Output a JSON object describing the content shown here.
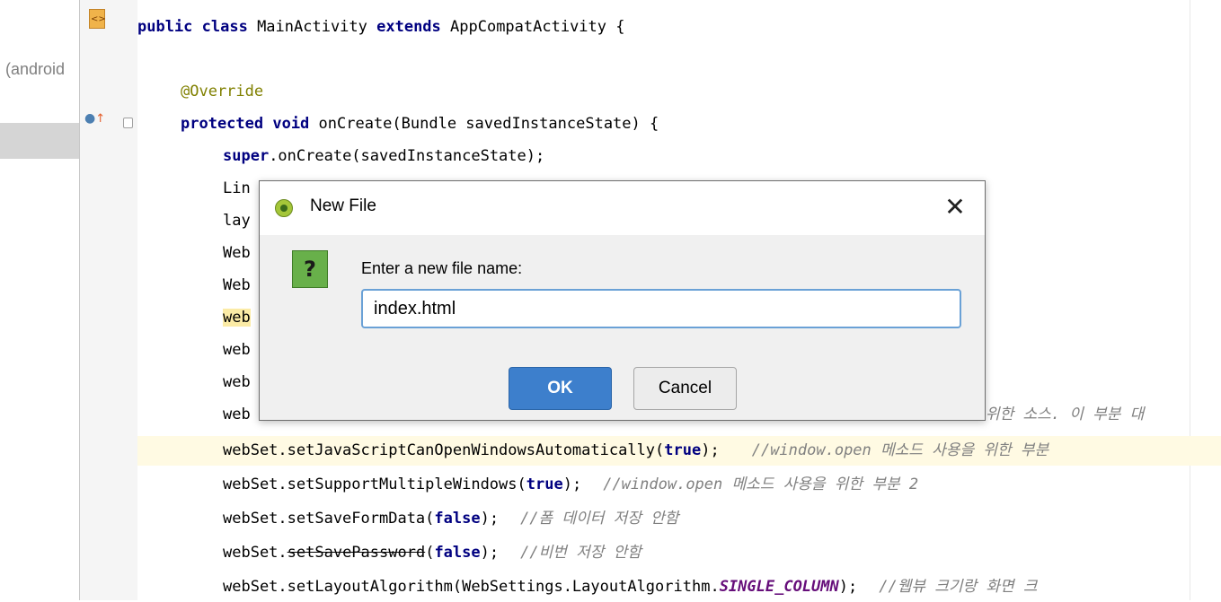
{
  "sidebar": {
    "project_label": "(android"
  },
  "gutter": {
    "file_icon_glyph": "<>"
  },
  "code": {
    "line_1": {
      "kw1": "public class",
      "t1": " MainActivity ",
      "kw2": "extends",
      "t2": " AppCompatActivity {"
    },
    "line_3": {
      "annotation": "@Override"
    },
    "line_4": {
      "kw1": "protected void",
      "t1": " onCreate(Bundle savedInstanceState) {"
    },
    "line_5": {
      "kw1": "super",
      "t1": ".onCreate(savedInstanceState);"
    },
    "line_6": "Lin",
    "line_7": "lay",
    "line_8": "Web",
    "line_9": "Web",
    "line_10": "web",
    "line_11": "web",
    "line_12": "web",
    "line_13": {
      "t1": "web",
      "comment": "위한 소스. 이 부분 대"
    },
    "line_14": {
      "t1": "webSet.setJavaScriptCanOpenWindowsAutomatically(",
      "kw": "true",
      "t2": ");",
      "comment": "//window.open 메소드 사용을 위한 부분"
    },
    "line_15": {
      "t1": "webSet.setSupportMultipleWindows(",
      "kw": "true",
      "t2": ");",
      "comment": "//window.open 메소드 사용을 위한 부분 2"
    },
    "line_16": {
      "t1": "webSet.setSaveFormData(",
      "kw": "false",
      "t2": ");",
      "comment": "//폼 데이터 저장 안함"
    },
    "line_17": {
      "t1": "webSet.",
      "deprecated": "setSavePassword",
      "t2": "(",
      "kw": "false",
      "t3": ");",
      "comment": "//비번 저장 안함"
    },
    "line_18": {
      "t1": "webSet.setLayoutAlgorithm(WebSettings.LayoutAlgorithm.",
      "constant": "SINGLE_COLUMN",
      "t2": ");",
      "comment": "//웹뷰 크기랑 화면 크"
    }
  },
  "dialog": {
    "title": "New File",
    "close_glyph": "✕",
    "question_glyph": "?",
    "prompt": "Enter a new file name:",
    "filename_value": "index.html",
    "ok_label": "OK",
    "cancel_label": "Cancel"
  },
  "colors": {
    "keyword": "#000080",
    "annotation": "#808000",
    "comment": "#808080",
    "constant": "#660e7a",
    "ok_button": "#3d7fcc"
  },
  "icons": [
    "file-html-icon",
    "override-method-icon",
    "fold-icon",
    "android-studio-icon",
    "question-icon",
    "close-icon"
  ]
}
